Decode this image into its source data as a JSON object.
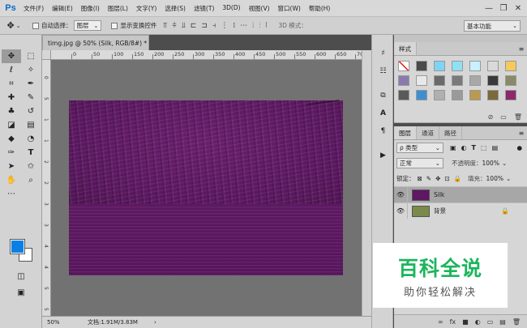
{
  "app": {
    "logo": "Ps"
  },
  "menu": [
    "文件(F)",
    "编辑(E)",
    "图像(I)",
    "图层(L)",
    "文字(Y)",
    "选择(S)",
    "滤镜(T)",
    "3D(D)",
    "视图(V)",
    "窗口(W)",
    "帮助(H)"
  ],
  "window_controls": {
    "minimize": "—",
    "restore": "❐",
    "close": "✕"
  },
  "options": {
    "auto_select_label": "自动选择：",
    "auto_select_value": "图层",
    "show_transform_label": "显示变换控件",
    "mode_3d_label": "3D 模式：",
    "workspace_value": "基本功能"
  },
  "document": {
    "tab_title": "timg.jpg @ 50% (Silk, RGB/8#) *",
    "close_symbol": "×"
  },
  "ruler": {
    "top_labels": [
      "0",
      "50",
      "100",
      "150",
      "200",
      "250",
      "300",
      "350",
      "400",
      "450",
      "500",
      "550",
      "600",
      "650",
      "700"
    ],
    "left_labels": [
      "0",
      "5",
      "1",
      "1",
      "2",
      "2",
      "3",
      "3",
      "4",
      "4",
      "5",
      "5"
    ]
  },
  "status": {
    "zoom": "50%",
    "doc_info": "文档:1.91M/3.83M",
    "arrow": "›"
  },
  "styles_panel": {
    "tab": "样式",
    "menu_icon": "≡",
    "swatches": [
      "#ffffff",
      "#4a4a4a",
      "#7fd3f5",
      "#8fe0f5",
      "#c8f0ff",
      "#d9d9d9",
      "#f5c95a",
      "#8a7ab0",
      "#e8e8e8",
      "#6a6a6a",
      "#7a7a7a",
      "#a8a8a8",
      "#3a3a3a",
      "#8a8a6a",
      "#5a5a5a",
      "#3f8fd0",
      "#b0b0b0",
      "#9a9a9a",
      "#b89a50",
      "#7a6a3a",
      "#8a2a6a"
    ]
  },
  "layers_panel": {
    "tabs": [
      "图层",
      "通道",
      "路径"
    ],
    "menu_icon": "≡",
    "filter_label": "ρ 类型",
    "blend_mode": "正常",
    "opacity_label": "不透明度：",
    "opacity_value": "100%",
    "lock_label": "锁定：",
    "fill_label": "填充：",
    "fill_value": "100%",
    "layers": [
      {
        "name": "Silk",
        "color": "#5e1763",
        "selected": true
      },
      {
        "name": "背景",
        "color": "#7a8a4a",
        "selected": false
      }
    ],
    "footer_icons": [
      "∞",
      "fx",
      "■",
      "◐",
      "▭",
      "▤",
      "🗑"
    ]
  },
  "watermark": {
    "main": "百科全说",
    "sub": "助你轻松解决"
  },
  "colors": {
    "foreground": "#0a7fe6",
    "background": "#ffffff",
    "canvas_purple": "#6a1f70",
    "watermark_green": "#1cb55c"
  }
}
